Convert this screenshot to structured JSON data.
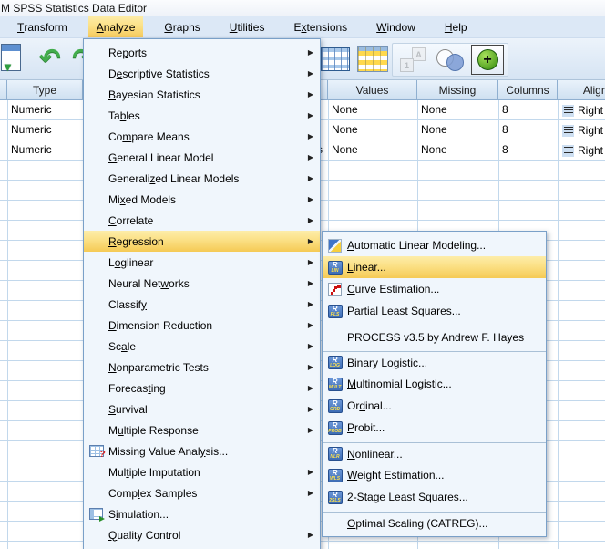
{
  "title_bar": {
    "title": "M SPSS Statistics Data Editor"
  },
  "menu_bar": {
    "items": [
      {
        "pre": "",
        "u": "T",
        "post": "ransform",
        "state": ""
      },
      {
        "pre": "",
        "u": "A",
        "post": "nalyze",
        "state": "active"
      },
      {
        "pre": "",
        "u": "G",
        "post": "raphs",
        "state": ""
      },
      {
        "pre": "",
        "u": "U",
        "post": "tilities",
        "state": ""
      },
      {
        "pre": "E",
        "u": "x",
        "post": "tensions",
        "state": ""
      },
      {
        "pre": "",
        "u": "W",
        "post": "indow",
        "state": ""
      },
      {
        "pre": "",
        "u": "H",
        "post": "elp",
        "state": ""
      }
    ]
  },
  "toolbar": {
    "left_icons": [
      {
        "icon": "open-data-icon"
      },
      {
        "icon": "undo-icon"
      },
      {
        "icon": "redo-icon"
      }
    ],
    "right_icons": [
      {
        "icon": "data-table-icon"
      },
      {
        "icon": "variables-table-icon"
      }
    ],
    "group_icons": [
      {
        "icon": "value-labels-icon",
        "state": "disabled"
      },
      {
        "icon": "split-file-venn-icon",
        "state": ""
      },
      {
        "icon": "insert-plus-icon",
        "state": "pressed"
      }
    ]
  },
  "grid": {
    "headers": {
      "row_num": "",
      "type": "Type",
      "hidden": "",
      "values": "Values",
      "missing": "Missing",
      "columns": "Columns",
      "alignment": "Alignment"
    },
    "rows": [
      {
        "type": "Numeric",
        "hidden": "",
        "values": "None",
        "missing": "None",
        "columns": "8",
        "align": "Right"
      },
      {
        "type": "Numeric",
        "hidden": "",
        "values": "None",
        "missing": "None",
        "columns": "8",
        "align": "Right"
      },
      {
        "type": "Numeric",
        "hidden": "s",
        "values": "None",
        "missing": "None",
        "columns": "8",
        "align": "Right"
      }
    ]
  },
  "analyze_menu": {
    "items": [
      {
        "pre": "Re",
        "u": "p",
        "post": "orts",
        "icon": "",
        "arrow": "▶",
        "state": "",
        "sep": ""
      },
      {
        "pre": "D",
        "u": "e",
        "post": "scriptive Statistics",
        "icon": "",
        "arrow": "▶",
        "state": "",
        "sep": ""
      },
      {
        "pre": "",
        "u": "B",
        "post": "ayesian Statistics",
        "icon": "",
        "arrow": "▶",
        "state": "",
        "sep": ""
      },
      {
        "pre": "Ta",
        "u": "b",
        "post": "les",
        "icon": "",
        "arrow": "▶",
        "state": "",
        "sep": ""
      },
      {
        "pre": "Co",
        "u": "m",
        "post": "pare Means",
        "icon": "",
        "arrow": "▶",
        "state": "",
        "sep": ""
      },
      {
        "pre": "",
        "u": "G",
        "post": "eneral Linear Model",
        "icon": "",
        "arrow": "▶",
        "state": "",
        "sep": ""
      },
      {
        "pre": "Generali",
        "u": "z",
        "post": "ed Linear Models",
        "icon": "",
        "arrow": "▶",
        "state": "",
        "sep": ""
      },
      {
        "pre": "Mi",
        "u": "x",
        "post": "ed Models",
        "icon": "",
        "arrow": "▶",
        "state": "",
        "sep": ""
      },
      {
        "pre": "",
        "u": "C",
        "post": "orrelate",
        "icon": "",
        "arrow": "▶",
        "state": "",
        "sep": ""
      },
      {
        "pre": "",
        "u": "R",
        "post": "egression",
        "icon": "",
        "arrow": "▶",
        "state": "highlight",
        "sep": ""
      },
      {
        "pre": "L",
        "u": "o",
        "post": "glinear",
        "icon": "",
        "arrow": "▶",
        "state": "",
        "sep": ""
      },
      {
        "pre": "Neural Net",
        "u": "w",
        "post": "orks",
        "icon": "",
        "arrow": "▶",
        "state": "",
        "sep": ""
      },
      {
        "pre": "Classif",
        "u": "y",
        "post": "",
        "icon": "",
        "arrow": "▶",
        "state": "",
        "sep": ""
      },
      {
        "pre": "",
        "u": "D",
        "post": "imension Reduction",
        "icon": "",
        "arrow": "▶",
        "state": "",
        "sep": ""
      },
      {
        "pre": "Sc",
        "u": "a",
        "post": "le",
        "icon": "",
        "arrow": "▶",
        "state": "",
        "sep": ""
      },
      {
        "pre": "",
        "u": "N",
        "post": "onparametric Tests",
        "icon": "",
        "arrow": "▶",
        "state": "",
        "sep": ""
      },
      {
        "pre": "Forecas",
        "u": "t",
        "post": "ing",
        "icon": "",
        "arrow": "▶",
        "state": "",
        "sep": ""
      },
      {
        "pre": "",
        "u": "S",
        "post": "urvival",
        "icon": "",
        "arrow": "▶",
        "state": "",
        "sep": ""
      },
      {
        "pre": "M",
        "u": "u",
        "post": "ltiple Response",
        "icon": "",
        "arrow": "▶",
        "state": "",
        "sep": ""
      },
      {
        "pre": "Missing Value Anal",
        "u": "y",
        "post": "sis...",
        "icon": "missing-value-analysis-icon",
        "arrow": "",
        "state": "",
        "sep": ""
      },
      {
        "pre": "Mul",
        "u": "t",
        "post": "iple Imputation",
        "icon": "",
        "arrow": "▶",
        "state": "",
        "sep": ""
      },
      {
        "pre": "Comp",
        "u": "l",
        "post": "ex Samples",
        "icon": "",
        "arrow": "▶",
        "state": "",
        "sep": ""
      },
      {
        "pre": "S",
        "u": "i",
        "post": "mulation...",
        "icon": "simulation-icon",
        "arrow": "",
        "state": "",
        "sep": ""
      },
      {
        "pre": "",
        "u": "Q",
        "post": "uality Control",
        "icon": "",
        "arrow": "▶",
        "state": "",
        "sep": ""
      }
    ]
  },
  "regression_submenu": {
    "items": [
      {
        "pre": "",
        "u": "A",
        "post": "utomatic Linear Modeling...",
        "icon": "auto-linear-modeling-icon",
        "abbr": "",
        "sep": "",
        "state": ""
      },
      {
        "pre": "",
        "u": "L",
        "post": "inear...",
        "icon": "linear-r-icon",
        "abbr": "LIN",
        "sep": "",
        "state": "highlight"
      },
      {
        "pre": "",
        "u": "C",
        "post": "urve Estimation...",
        "icon": "curve-estimation-icon",
        "abbr": "",
        "sep": "",
        "state": ""
      },
      {
        "pre": "Partial Lea",
        "u": "s",
        "post": "t Squares...",
        "icon": "pls-r-icon",
        "abbr": "PLS",
        "sep": "",
        "state": ""
      },
      {
        "pre": "PROCESS v3.5 by Andrew F. Hayes",
        "u": "",
        "post": "",
        "icon": "",
        "abbr": "",
        "sep": "yes",
        "state": ""
      },
      {
        "pre": "Binary Lo",
        "u": "g",
        "post": "istic...",
        "icon": "binary-logistic-r-icon",
        "abbr": "LOG",
        "sep": "yes",
        "state": ""
      },
      {
        "pre": "",
        "u": "M",
        "post": "ultinomial Logistic...",
        "icon": "multinomial-logistic-r-icon",
        "abbr": "MULT",
        "sep": "",
        "state": ""
      },
      {
        "pre": "Or",
        "u": "d",
        "post": "inal...",
        "icon": "ordinal-r-icon",
        "abbr": "ORD",
        "sep": "",
        "state": ""
      },
      {
        "pre": "",
        "u": "P",
        "post": "robit...",
        "icon": "probit-r-icon",
        "abbr": "PROB",
        "sep": "",
        "state": ""
      },
      {
        "pre": "",
        "u": "N",
        "post": "onlinear...",
        "icon": "nonlinear-r-icon",
        "abbr": "NLR",
        "sep": "yes",
        "state": ""
      },
      {
        "pre": "",
        "u": "W",
        "post": "eight Estimation...",
        "icon": "weight-estimation-r-icon",
        "abbr": "WLS",
        "sep": "",
        "state": ""
      },
      {
        "pre": "",
        "u": "2",
        "post": "-Stage Least Squares...",
        "icon": "two-stage-ls-r-icon",
        "abbr": "2SLS",
        "sep": "",
        "state": ""
      },
      {
        "pre": "",
        "u": "O",
        "post": "ptimal Scaling (CATREG)...",
        "icon": "",
        "abbr": "",
        "sep": "yes",
        "state": ""
      }
    ]
  }
}
